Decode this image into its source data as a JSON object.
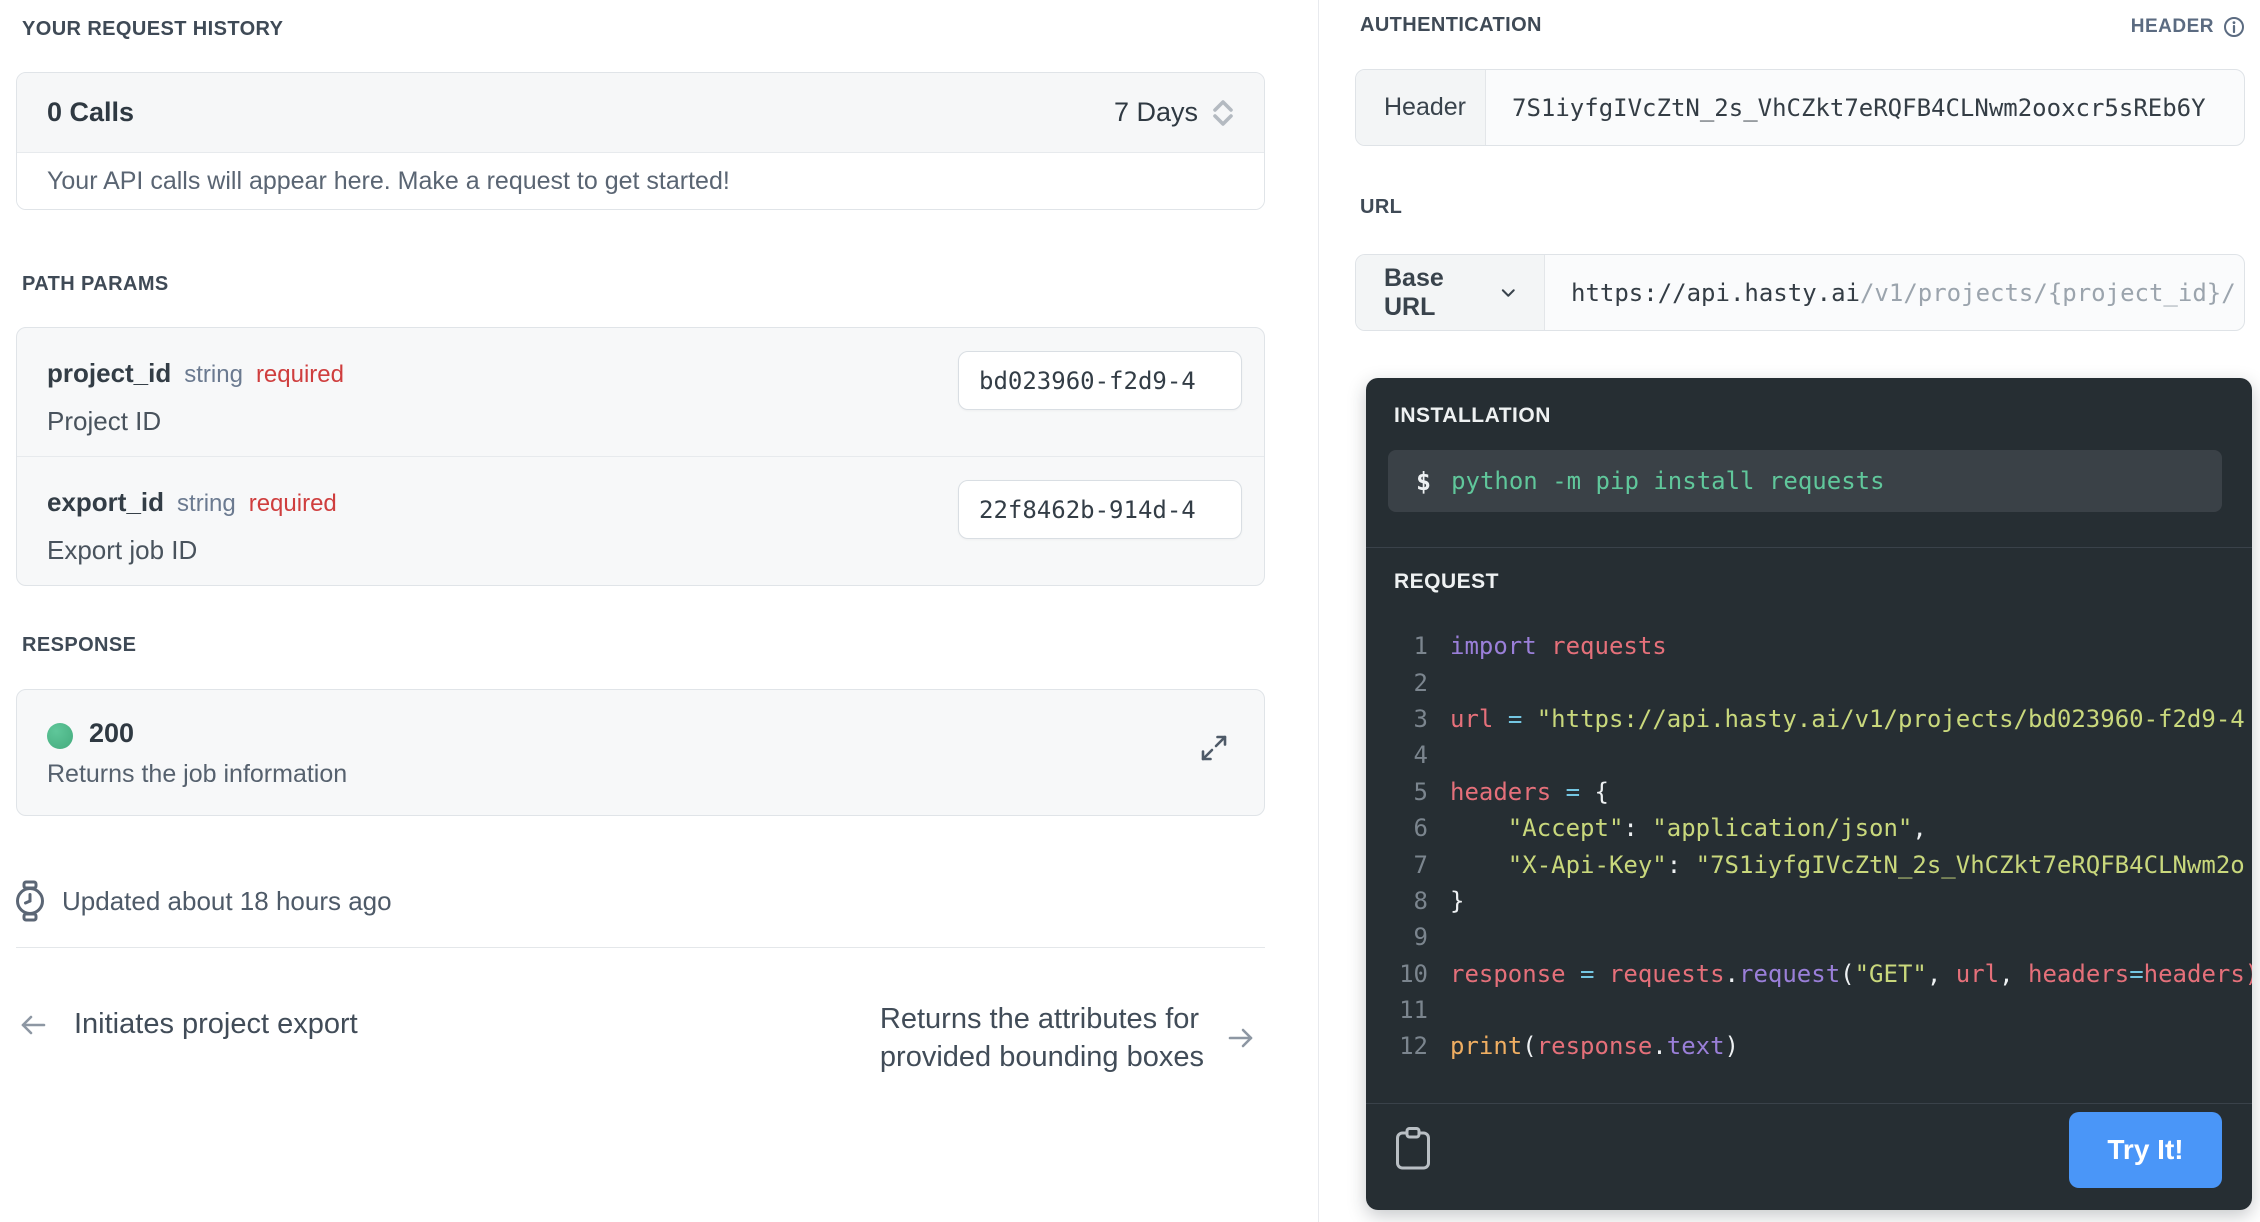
{
  "left": {
    "request_history": {
      "title": "YOUR REQUEST HISTORY",
      "calls": "0 Calls",
      "period": "7 Days",
      "empty_message": "Your API calls will appear here. Make a request to get started!"
    },
    "path_params": {
      "title": "PATH PARAMS",
      "params": [
        {
          "name": "project_id",
          "type": "string",
          "flag": "required",
          "description": "Project ID",
          "value": "bd023960-f2d9-4"
        },
        {
          "name": "export_id",
          "type": "string",
          "flag": "required",
          "description": "Export job ID",
          "value": "22f8462b-914d-4"
        }
      ]
    },
    "response": {
      "title": "RESPONSE",
      "status_code": "200",
      "status_color": "#4cb485",
      "description": "Returns the job information"
    },
    "updated": "Updated about 18 hours ago",
    "footer": {
      "prev_label": "Initiates project export",
      "next_lines": [
        "Returns the attributes for",
        "provided bounding boxes"
      ]
    }
  },
  "right": {
    "authentication": {
      "title": "AUTHENTICATION",
      "kind": "HEADER",
      "field_label": "Header",
      "field_value": "7S1iyfgIVcZtN_2s_VhCZkt7eRQFB4CLNwm2ooxcr5sREb6Y"
    },
    "url": {
      "title": "URL",
      "base_label": "Base URL",
      "base": "https://api.hasty.ai",
      "path": "/v1/projects/{project_id}/"
    },
    "code_panel": {
      "installation_title": "INSTALLATION",
      "shell_prompt": "$",
      "shell_command": "python -m pip install requests",
      "request_title": "REQUEST",
      "try_button": "Try It!",
      "code_lines": [
        {
          "n": "1",
          "tokens": [
            [
              "import",
              "kw"
            ],
            [
              " ",
              "pl"
            ],
            [
              "requests",
              "var"
            ]
          ]
        },
        {
          "n": "2",
          "tokens": []
        },
        {
          "n": "3",
          "tokens": [
            [
              "url",
              "var"
            ],
            [
              " ",
              "pl"
            ],
            [
              "=",
              "op"
            ],
            [
              " ",
              "pl"
            ],
            [
              "\"https://api.hasty.ai/v1/projects/bd023960-f2d9-4",
              "str"
            ]
          ]
        },
        {
          "n": "4",
          "tokens": []
        },
        {
          "n": "5",
          "tokens": [
            [
              "headers",
              "var"
            ],
            [
              " ",
              "pl"
            ],
            [
              "=",
              "op"
            ],
            [
              " ",
              "pl"
            ],
            [
              "{",
              "pl"
            ]
          ]
        },
        {
          "n": "6",
          "tokens": [
            [
              "    ",
              "pl"
            ],
            [
              "\"Accept\"",
              "str"
            ],
            [
              ": ",
              "pl"
            ],
            [
              "\"application/json\"",
              "str"
            ],
            [
              ",",
              "pl"
            ]
          ]
        },
        {
          "n": "7",
          "tokens": [
            [
              "    ",
              "pl"
            ],
            [
              "\"X-Api-Key\"",
              "str"
            ],
            [
              ": ",
              "pl"
            ],
            [
              "\"7S1iyfgIVcZtN_2s_VhCZkt7eRQFB4CLNwm2o",
              "str"
            ]
          ]
        },
        {
          "n": "8",
          "tokens": [
            [
              "}",
              "pl"
            ]
          ]
        },
        {
          "n": "9",
          "tokens": []
        },
        {
          "n": "10",
          "tokens": [
            [
              "response",
              "var"
            ],
            [
              " ",
              "pl"
            ],
            [
              "=",
              "op"
            ],
            [
              " ",
              "pl"
            ],
            [
              "requests",
              "var"
            ],
            [
              ".",
              "pl"
            ],
            [
              "request",
              "kw"
            ],
            [
              "(",
              "pl"
            ],
            [
              "\"GET\"",
              "str"
            ],
            [
              ", ",
              "pl"
            ],
            [
              "url",
              "var"
            ],
            [
              ", ",
              "pl"
            ],
            [
              "headers",
              "var"
            ],
            [
              "=",
              "op"
            ],
            [
              "headers)",
              "var"
            ]
          ]
        },
        {
          "n": "11",
          "tokens": []
        },
        {
          "n": "12",
          "tokens": [
            [
              "print",
              "fn"
            ],
            [
              "(",
              "pl"
            ],
            [
              "response",
              "var"
            ],
            [
              ".",
              "pl"
            ],
            [
              "text",
              "kw"
            ],
            [
              ")",
              "pl"
            ]
          ]
        }
      ]
    }
  },
  "colors": {
    "accent_blue": "#4a96f8",
    "status_green": "#4cb485",
    "required_red": "#cf3e3e",
    "panel_dark": "#262e33",
    "panel_light": "#3a4147"
  }
}
